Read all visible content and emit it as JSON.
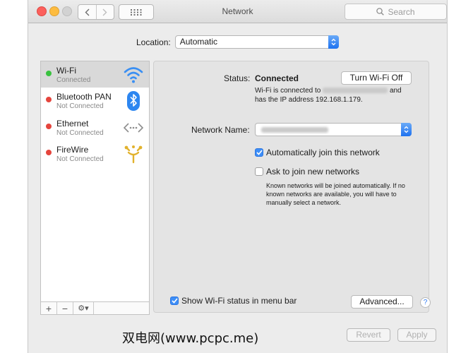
{
  "window": {
    "title": "Network"
  },
  "search": {
    "placeholder": "Search",
    "icon": "search-icon"
  },
  "location": {
    "label": "Location:",
    "value": "Automatic"
  },
  "services": [
    {
      "name": "Wi-Fi",
      "status": "Connected",
      "dot": "#39c23f",
      "icon": "wifi-icon",
      "selected": true
    },
    {
      "name": "Bluetooth PAN",
      "status": "Not Connected",
      "dot": "#e5453d",
      "icon": "bluetooth-icon"
    },
    {
      "name": "Ethernet",
      "status": "Not Connected",
      "dot": "#e5453d",
      "icon": "ethernet-icon"
    },
    {
      "name": "FireWire",
      "status": "Not Connected",
      "dot": "#e5453d",
      "icon": "firewire-icon"
    }
  ],
  "toolbar": {
    "add": "+",
    "remove": "−",
    "gear": "⚙▾"
  },
  "detail": {
    "status_label": "Status:",
    "status_value": "Connected",
    "turn_off_button": "Turn Wi-Fi Off",
    "desc_line1_prefix": "Wi-Fi is connected to",
    "desc_line1_suffix": "and",
    "desc_line2": "has the IP address 192.168.1.179.",
    "network_name_label": "Network Name:",
    "auto_join_label": "Automatically join this network",
    "auto_join_checked": true,
    "ask_join_label": "Ask to join new networks",
    "ask_join_checked": false,
    "ask_join_note": "Known networks will be joined automatically. If no known networks are available, you will have to manually select a network.",
    "show_status_label": "Show Wi-Fi status in menu bar",
    "show_status_checked": true,
    "advanced_button": "Advanced...",
    "help_button": "?"
  },
  "footer": {
    "revert_button": "Revert",
    "apply_button": "Apply"
  },
  "watermark": "双电网(www.pcpc.me)",
  "colors": {
    "accent": "#3d8ef7",
    "connected": "#39c23f",
    "not_connected": "#e5453d"
  }
}
